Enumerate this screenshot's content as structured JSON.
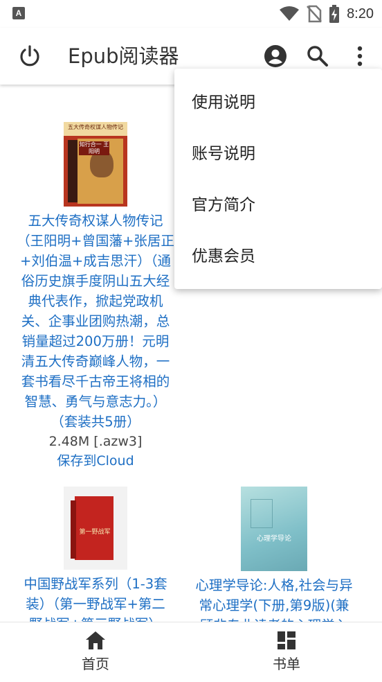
{
  "status_bar": {
    "time": "8:20",
    "app_badge": "A",
    "icons": [
      "wifi-icon",
      "no-sim-icon",
      "battery-charging-icon"
    ]
  },
  "app_bar": {
    "title": "Epub阅读器",
    "icons": [
      "power-icon",
      "account-icon",
      "search-icon",
      "more-vert-icon"
    ]
  },
  "menu": {
    "items": [
      "使用说明",
      "账号说明",
      "官方简介",
      "优惠会员"
    ]
  },
  "books": [
    {
      "title_lines": [
        "五大传奇权谋人物传记",
        "（王阳明+曾国藩+张居正",
        "+刘伯温+成吉思汗）（通",
        "俗历史旗手度阴山五大经",
        "典代表作，掀起党政机",
        "关、企事业团购热潮，总",
        "销量超过200万册！元明",
        "清五大传奇巅峰人物，一",
        "套书看尽千古帝王将相的",
        "智慧、勇气与意志力。）",
        "（套装共5册）"
      ],
      "meta": "2.48M [.azw3]",
      "link": "保存到Cloud",
      "cover_text": "五大传奇权谋人物传记",
      "cover_sub": "知行合一 王阳明"
    },
    {
      "title_lines": [
        "中国野战军系列（1-3套",
        "装）（第一野战军+第二",
        "野战军+第三野战军）"
      ],
      "cover_text": "第一野战军"
    },
    {
      "title_lines": [
        "心理学导论:人格,社会与异",
        "常心理学(下册,第9版)(兼",
        "顾非专业读者的心理学入"
      ],
      "cover_text": "心理学导论"
    }
  ],
  "bottom_nav": {
    "items": [
      {
        "label": "首页",
        "icon": "home-icon"
      },
      {
        "label": "书单",
        "icon": "dashboard-icon"
      }
    ]
  },
  "colors": {
    "link": "#1e6fc4",
    "text": "#333333",
    "icon": "#333333"
  }
}
